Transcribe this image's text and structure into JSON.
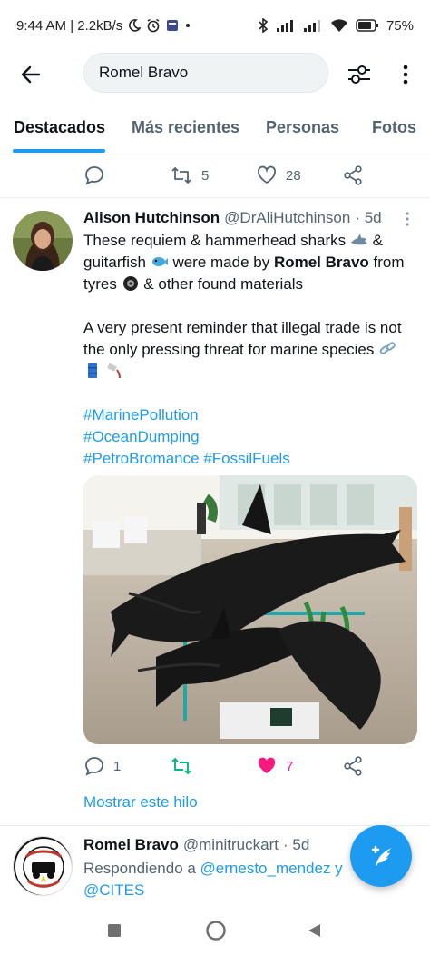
{
  "status_bar": {
    "time": "9:44 AM | 2.2kB/s",
    "battery": "75%",
    "icons": [
      "moon-icon",
      "alarm-icon",
      "notification-icon",
      "dot-icon",
      "bluetooth-icon",
      "signal-icon",
      "signal-icon",
      "wifi-icon",
      "battery-icon"
    ]
  },
  "header": {
    "search_value": "Romel Bravo",
    "back_icon": "arrow-left-icon",
    "filter_icon": "sliders-icon",
    "more_icon": "more-vertical-icon"
  },
  "tabs": [
    {
      "label": "Destacados",
      "active": true
    },
    {
      "label": "Más recientes",
      "active": false
    },
    {
      "label": "Personas",
      "active": false
    },
    {
      "label": "Fotos",
      "active": false
    }
  ],
  "prev_tweet_actions": {
    "replies": "",
    "retweets": "5",
    "likes": "28"
  },
  "tweet": {
    "name": "Alison Hutchinson",
    "handle": "@DrAliHutchinson",
    "time": "· 5d",
    "text_1a": "These requiem & hammerhead sharks",
    "text_1b": " & guitarfish",
    "text_1c": " were made by ",
    "text_1d": "Romel Bravo",
    "text_1e": " from tyres",
    "text_1f": " & other found materials",
    "text_2": "A very present reminder that illegal trade is not the only pressing threat for marine species",
    "hashtags": [
      "#MarinePollution",
      "#OceanDumping",
      "#PetroBromance",
      "#FossilFuels"
    ],
    "replies": "1",
    "retweets": "",
    "likes": "7",
    "liked": true,
    "retweeted": true,
    "colors": {
      "accent": "#1d9bf0",
      "retweet": "#00ba7c",
      "like": "#f91880"
    }
  },
  "show_thread": "Mostrar este hilo",
  "next_tweet": {
    "name": "Romel Bravo",
    "handle": "@minitruckart",
    "time": "· 5d",
    "reply_prefix": "Respondiendo a ",
    "reply_user_1": "@ernesto_mendez y",
    "reply_user_2": "@CITES"
  },
  "fab": {
    "icon": "compose-tweet-icon"
  },
  "nav": {
    "icons": [
      "recents-square-icon",
      "home-circle-icon",
      "back-triangle-icon"
    ]
  }
}
